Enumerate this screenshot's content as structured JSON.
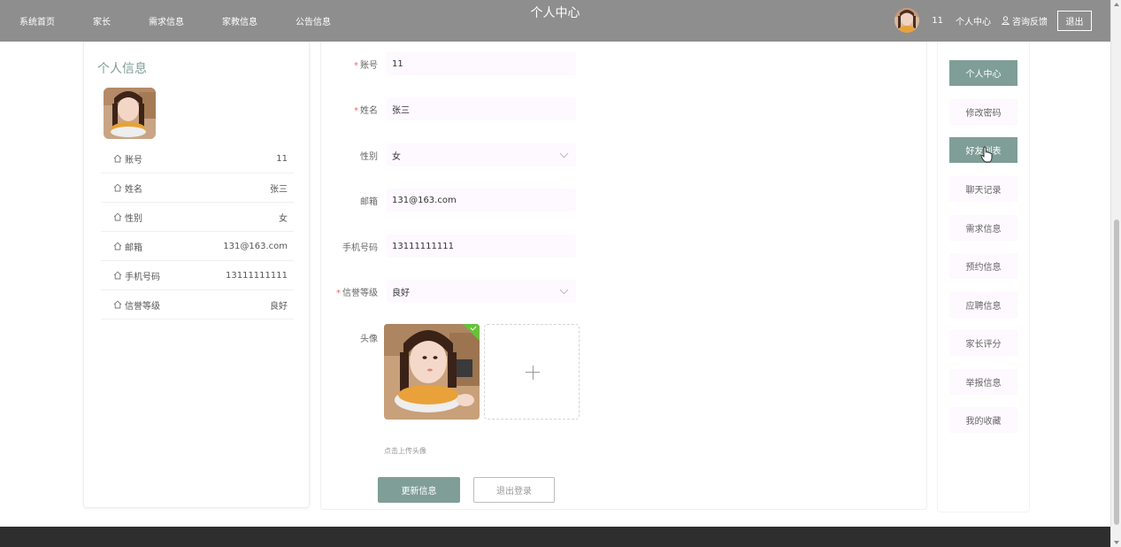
{
  "nav": {
    "links": [
      "系统首页",
      "家长",
      "需求信息",
      "家教信息",
      "公告信息"
    ],
    "center_title": "个人中心",
    "user_id": "11",
    "personal_center": "个人中心",
    "feedback": "咨询反馈",
    "logout": "退出"
  },
  "left": {
    "title": "个人信息",
    "rows": [
      {
        "label": "账号",
        "value": "11"
      },
      {
        "label": "姓名",
        "value": "张三"
      },
      {
        "label": "性别",
        "value": "女"
      },
      {
        "label": "邮箱",
        "value": "131@163.com"
      },
      {
        "label": "手机号码",
        "value": "13111111111"
      },
      {
        "label": "信誉等级",
        "value": "良好"
      }
    ]
  },
  "form": {
    "account_label": "账号",
    "account_value": "11",
    "name_label": "姓名",
    "name_value": "张三",
    "gender_label": "性别",
    "gender_value": "女",
    "email_label": "邮箱",
    "email_value": "131@163.com",
    "phone_label": "手机号码",
    "phone_value": "13111111111",
    "credit_label": "信誉等级",
    "credit_value": "良好",
    "avatar_label": "头像",
    "upload_hint": "点击上传头像",
    "update_button": "更新信息",
    "logout_button": "退出登录",
    "required_mark": "*"
  },
  "menu": {
    "items": [
      "个人中心",
      "修改密码",
      "好友列表",
      "聊天记录",
      "需求信息",
      "预约信息",
      "应聘信息",
      "家长评分",
      "举报信息",
      "我的收藏"
    ],
    "active_index": 0,
    "hover_index": 2
  },
  "colors": {
    "nav_bg": "#8e8e8e",
    "accent": "#7f9e97",
    "input_bg": "#fdf9fe",
    "required": "#e46a6a",
    "success": "#67c23a",
    "footer_bg": "#2e2e2e"
  }
}
